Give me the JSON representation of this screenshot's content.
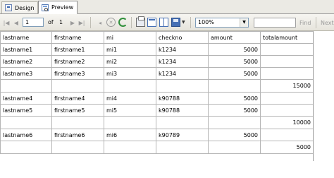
{
  "tabs": [
    {
      "label": "Design",
      "icon": "design-icon"
    },
    {
      "label": "Preview",
      "icon": "preview-icon"
    }
  ],
  "toolbar": {
    "page_value": "1",
    "of_label": "of",
    "total_pages": "1",
    "zoom_value": "100%",
    "find_placeholder": "",
    "find_label": "Find",
    "next_label": "Next"
  },
  "report": {
    "headers": [
      "lastname",
      "firstname",
      "mi",
      "checkno",
      "amount",
      "totalamount"
    ],
    "rows": [
      [
        "lastname1",
        "firstname1",
        "mi1",
        "k1234",
        "5000",
        ""
      ],
      [
        "lastname2",
        "firstname2",
        "mi2",
        "k1234",
        "5000",
        ""
      ],
      [
        "lastname3",
        "firstname3",
        "mi3",
        "k1234",
        "5000",
        ""
      ],
      [
        "",
        "",
        "",
        "",
        "",
        "15000"
      ],
      [
        "lastname4",
        "firstname4",
        "mi4",
        "k90788",
        "5000",
        ""
      ],
      [
        "lastname5",
        "firstname5",
        "mi5",
        "k90788",
        "5000",
        ""
      ],
      [
        "",
        "",
        "",
        "",
        "",
        "10000"
      ],
      [
        "lastname6",
        "firstname6",
        "mi6",
        "k90789",
        "5000",
        ""
      ],
      [
        "",
        "",
        "",
        "",
        "",
        "5000"
      ]
    ]
  }
}
